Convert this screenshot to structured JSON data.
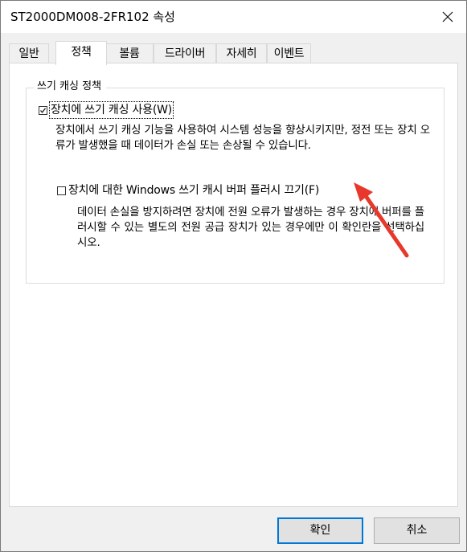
{
  "window": {
    "title": "ST2000DM008-2FR102 속성"
  },
  "tabs": [
    {
      "label": "일반",
      "active": false
    },
    {
      "label": "정책",
      "active": true
    },
    {
      "label": "볼륨",
      "active": false
    },
    {
      "label": "드라이버",
      "active": false
    },
    {
      "label": "자세히",
      "active": false
    },
    {
      "label": "이벤트",
      "active": false
    }
  ],
  "policy": {
    "group_title": "쓰기 캐싱 정책",
    "enable_cache": {
      "label": "장치에 쓰기 캐싱 사용(W)",
      "checked": true,
      "description": "장치에서 쓰기 캐싱 기능을 사용하여 시스템 성능을 향상시키지만, 정전 또는 장치 오류가 발생했을 때 데이터가 손실 또는 손상될 수 있습니다."
    },
    "disable_flush": {
      "label": "장치에 대한 Windows 쓰기 캐시 버퍼 플러시 끄기(F)",
      "checked": false,
      "description": "데이터 손실을 방지하려면 장치에 전원 오류가 발생하는 경우 장치에 버퍼를 플러시할 수 있는 별도의 전원 공급 장치가 있는 경우에만 이 확인란을 선택하십시오."
    }
  },
  "buttons": {
    "ok": "확인",
    "cancel": "취소"
  },
  "colors": {
    "annotation_arrow": "#e8372b",
    "focus_border": "#0078d7"
  }
}
